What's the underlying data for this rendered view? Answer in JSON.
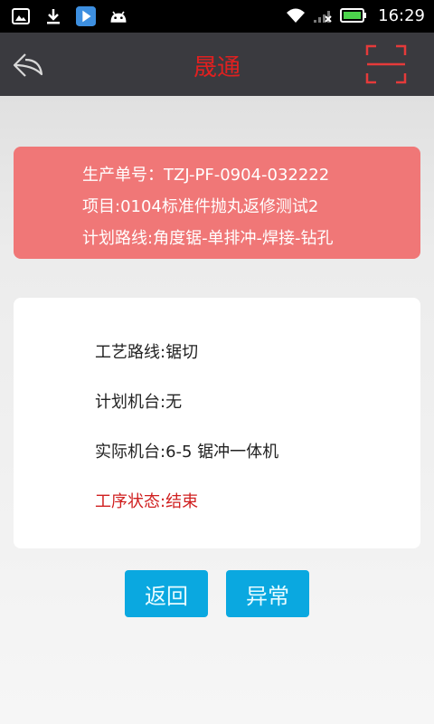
{
  "statusbar": {
    "time": "16:29",
    "icons": [
      "image-icon",
      "download-icon",
      "play-store-icon",
      "android-icon"
    ]
  },
  "header": {
    "title": "晟通"
  },
  "order": {
    "order_no": "生产单号：TZJ-PF-0904-032222",
    "project": "项目:0104标准件抛丸返修测试2",
    "route": "计划路线:角度锯-单排冲-焊接-钻孔"
  },
  "detail": {
    "process_route": "工艺路线:锯切",
    "planned_machine": "计划机台:无",
    "actual_machine": "实际机台:6-5 锯冲一体机",
    "status": "工序状态:结束"
  },
  "buttons": {
    "back": "返回",
    "exception": "异常"
  },
  "colors": {
    "header_bg": "#3a3a3f",
    "title": "#e02020",
    "order_card": "#f07777",
    "status_text": "#d02020",
    "button": "#0aa8e0"
  }
}
